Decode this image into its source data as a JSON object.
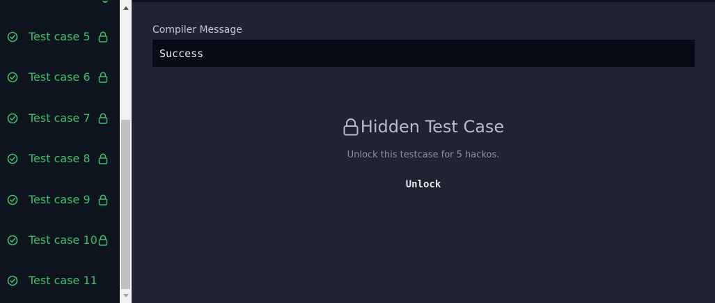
{
  "sidebar": {
    "test_cases": [
      {
        "label": "Test case 5",
        "locked": true
      },
      {
        "label": "Test case 6",
        "locked": true
      },
      {
        "label": "Test case 7",
        "locked": true
      },
      {
        "label": "Test case 8",
        "locked": true
      },
      {
        "label": "Test case 9",
        "locked": true
      },
      {
        "label": "Test case 10",
        "locked": true
      },
      {
        "label": "Test case 11",
        "locked": false
      }
    ],
    "status_color": "#39c069",
    "icons": {
      "status": "check-circle-icon",
      "lock": "lock-icon"
    }
  },
  "main": {
    "compiler_message_label": "Compiler Message",
    "compiler_message_value": "Success",
    "hidden": {
      "title": "Hidden Test Case",
      "subtitle": "Unlock this testcase for 5 hackos.",
      "unlock_label": "Unlock",
      "icon": "lock-icon"
    }
  }
}
